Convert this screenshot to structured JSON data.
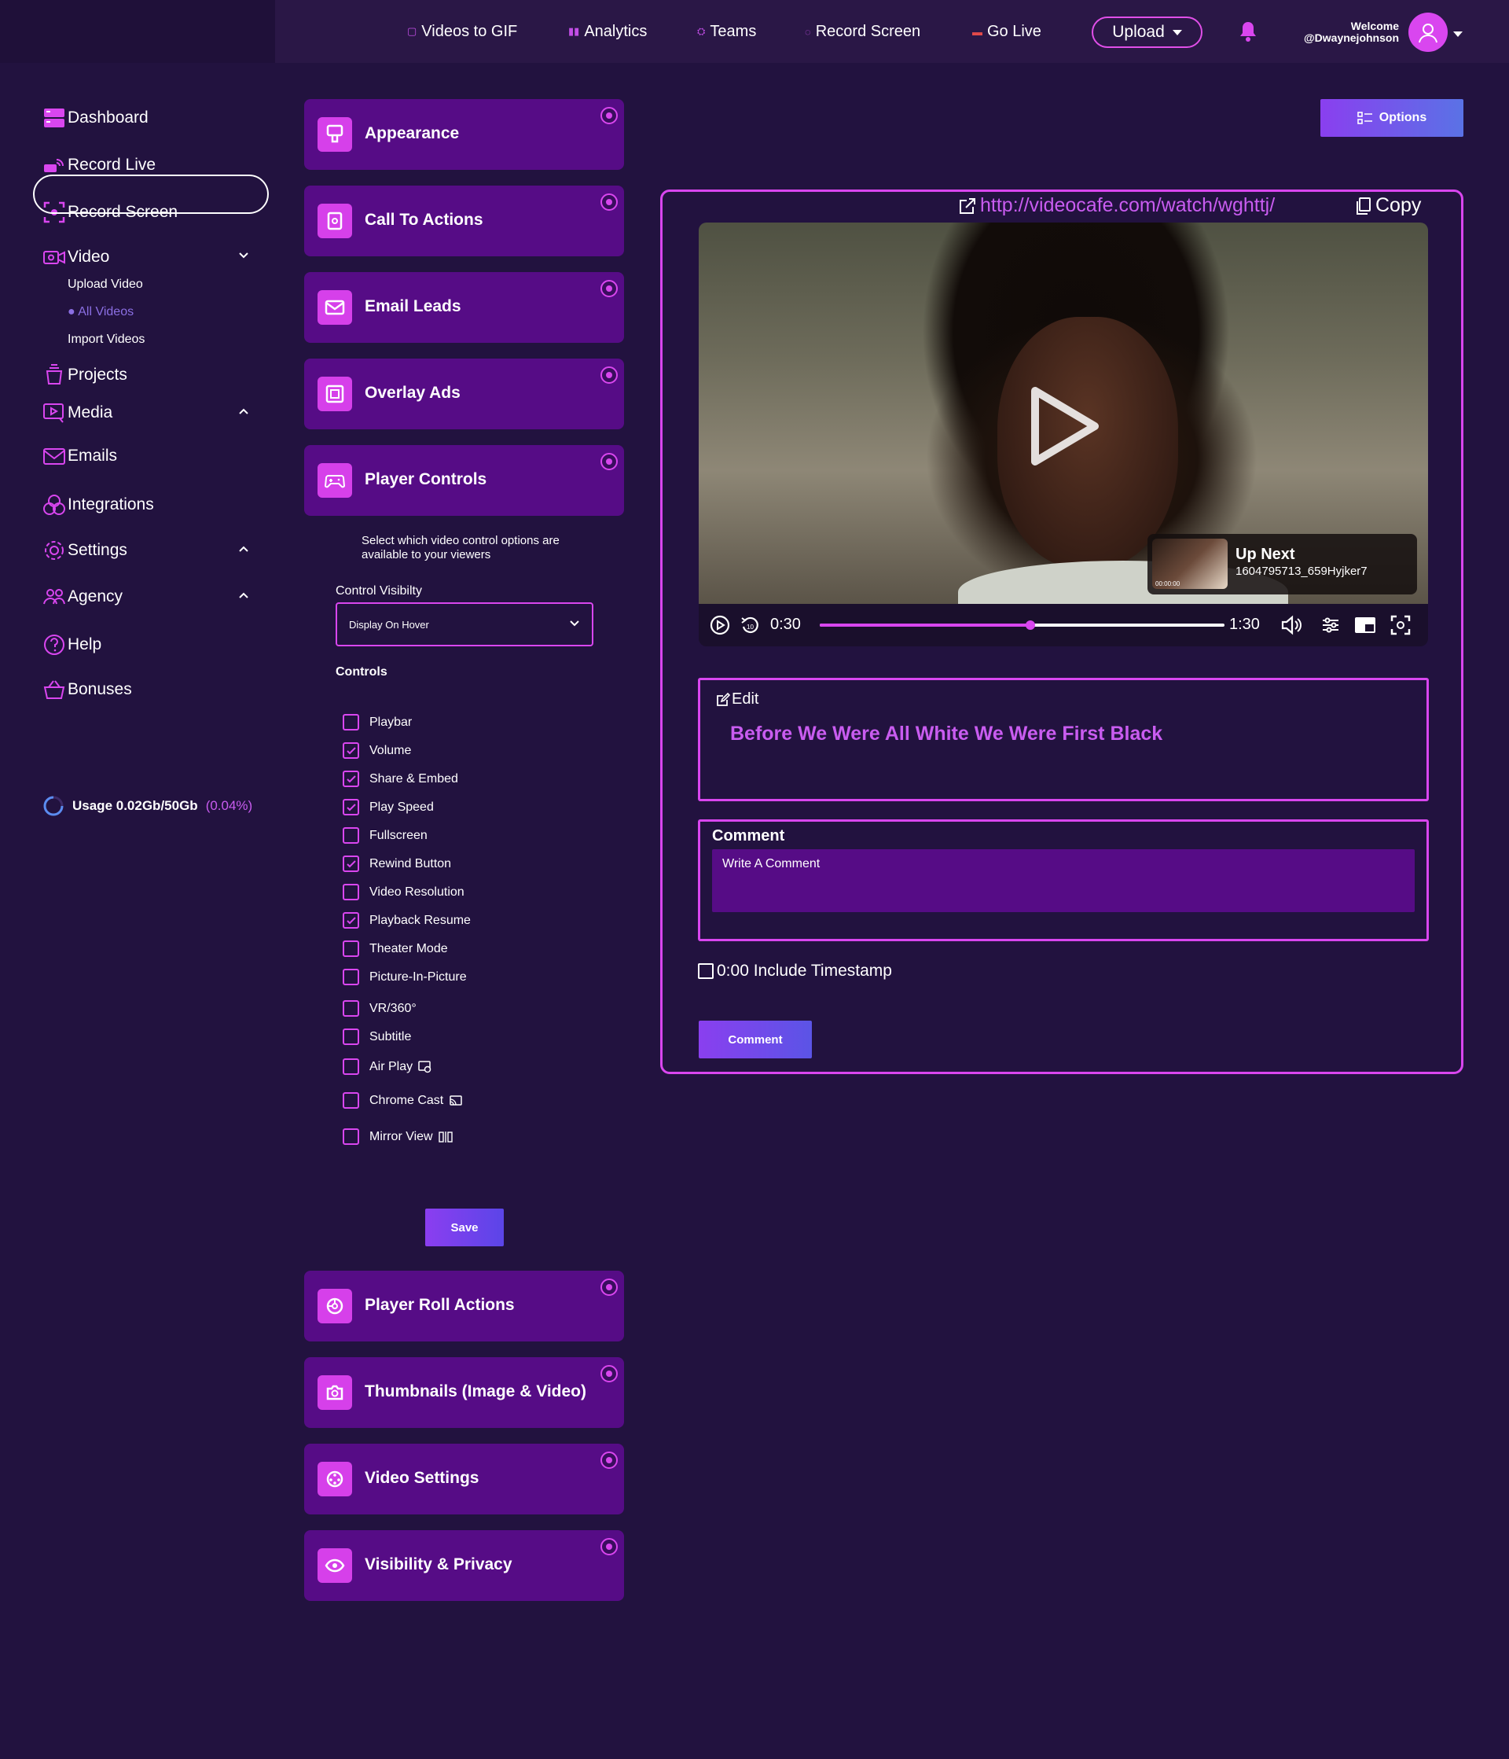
{
  "topnav": {
    "items": [
      {
        "label": "Videos to GIF",
        "icon": "gif-icon"
      },
      {
        "label": "Analytics",
        "icon": "analytics-icon"
      },
      {
        "label": "Teams",
        "icon": "teams-icon"
      },
      {
        "label": "Record Screen",
        "icon": "record-screen-icon"
      },
      {
        "label": "Go Live",
        "icon": "live-icon"
      }
    ],
    "upload_label": "Upload",
    "welcome": "Welcome",
    "username": "@Dwaynejohnson"
  },
  "sidebar": {
    "items": [
      {
        "label": "Dashboard",
        "icon": "dashboard-icon"
      },
      {
        "label": "Record Live",
        "icon": "record-live-icon"
      },
      {
        "label": "Record Screen",
        "icon": "record-screen-icon"
      },
      {
        "label": "Video",
        "icon": "video-icon"
      },
      {
        "label": "Projects",
        "icon": "projects-icon"
      },
      {
        "label": "Media",
        "icon": "media-icon"
      },
      {
        "label": "Emails",
        "icon": "email-icon"
      },
      {
        "label": "Integrations",
        "icon": "integrations-icon"
      },
      {
        "label": "Settings",
        "icon": "settings-icon"
      },
      {
        "label": "Agency",
        "icon": "agency-icon"
      },
      {
        "label": "Help",
        "icon": "help-icon"
      },
      {
        "label": "Bonuses",
        "icon": "bonuses-icon"
      }
    ],
    "video_sub": [
      "Upload Video",
      "All Videos",
      "Import Videos"
    ],
    "usage_label": "Usage 0.02Gb/50Gb",
    "usage_pct": "(0.04%)"
  },
  "accordion": {
    "items": [
      {
        "label": "Appearance",
        "icon": "appearance-icon"
      },
      {
        "label": "Call To Actions",
        "icon": "cta-icon"
      },
      {
        "label": "Email Leads",
        "icon": "email-icon"
      },
      {
        "label": "Overlay Ads",
        "icon": "overlay-icon"
      },
      {
        "label": "Player Controls",
        "icon": "gamepad-icon"
      },
      {
        "label": "Player Roll Actions",
        "icon": "roll-icon"
      },
      {
        "label": "Thumbnails (Image & Video)",
        "icon": "camera-icon"
      },
      {
        "label": "Video Settings",
        "icon": "video-settings-icon"
      },
      {
        "label": "Visibility & Privacy",
        "icon": "eye-icon"
      }
    ]
  },
  "player_controls": {
    "description": "Select which video control options are available to your viewers",
    "visibility_label": "Control Visibilty",
    "visibility_value": "Display On Hover",
    "controls_label": "Controls",
    "controls": [
      {
        "label": "Playbar",
        "checked": false
      },
      {
        "label": "Volume",
        "checked": true
      },
      {
        "label": "Share & Embed",
        "checked": true
      },
      {
        "label": "Play Speed",
        "checked": true
      },
      {
        "label": "Fullscreen",
        "checked": false
      },
      {
        "label": "Rewind Button",
        "checked": true
      },
      {
        "label": "Video Resolution",
        "checked": false
      },
      {
        "label": "Playback Resume",
        "checked": true
      },
      {
        "label": "Theater Mode",
        "checked": false
      },
      {
        "label": "Picture-In-Picture",
        "checked": false
      },
      {
        "label": "VR/360°",
        "checked": false
      },
      {
        "label": "Subtitle",
        "checked": false
      },
      {
        "label": "Air Play",
        "checked": false,
        "icon": "airplay-icon"
      },
      {
        "label": "Chrome Cast",
        "checked": false,
        "icon": "cast-icon"
      },
      {
        "label": "Mirror View",
        "checked": false,
        "icon": "mirror-icon"
      }
    ],
    "save_label": "Save"
  },
  "player": {
    "options_label": "Options",
    "share_url": "http://videocafe.com/watch/wghttj/",
    "copy_label": "Copy",
    "up_next_label": "Up Next",
    "up_next_name": "1604795713_659Hyjker7",
    "up_next_thumb_time": "00:00:00",
    "current_time": "0:30",
    "duration": "1:30",
    "progress": 0.52,
    "edit_label": "Edit",
    "video_title": "Before We Were All White We Were First Black",
    "comment_label": "Comment",
    "comment_placeholder": "Write A Comment",
    "timestamp_label": "0:00 Include Timestamp",
    "comment_button": "Comment"
  },
  "colors": {
    "accent": "#d946ef",
    "panel": "#560c86",
    "background": "#22123f"
  }
}
